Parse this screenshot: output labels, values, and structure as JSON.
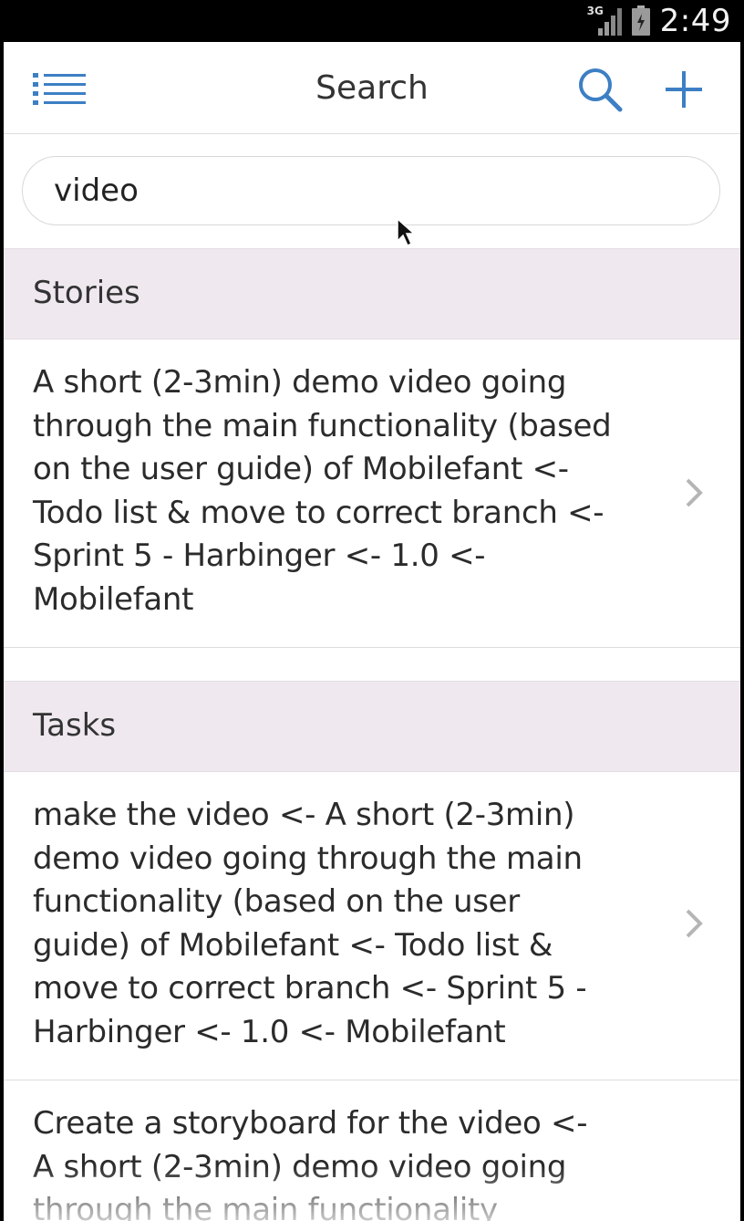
{
  "status_bar": {
    "network_type": "3G",
    "time": "2:49"
  },
  "app_bar": {
    "title": "Search",
    "menu_icon": "list-menu-icon",
    "search_icon": "search-icon",
    "add_icon": "plus-icon",
    "accent_color": "#3d7fc4"
  },
  "search": {
    "value": "video"
  },
  "sections": {
    "stories": {
      "title": "Stories",
      "items": [
        {
          "text": "A short (2-3min) demo video going through the main functionality (based on the user guide) of Mobilefant <- Todo list & move to correct branch <- Sprint 5 - Harbinger <- 1.0 <- Mobilefant"
        }
      ]
    },
    "tasks": {
      "title": "Tasks",
      "items": [
        {
          "text": "make the video <- A short (2-3min) demo video going through the main functionality (based on the user guide) of Mobilefant <- Todo list & move to correct branch <- Sprint 5 - Harbinger <- 1.0 <- Mobilefant"
        },
        {
          "text": "Create a storyboard for the video <- A short (2-3min) demo video going through the main functionality"
        }
      ]
    }
  },
  "colors": {
    "section_header_bg": "#efe9ef",
    "chevron": "#b5b5b5"
  }
}
